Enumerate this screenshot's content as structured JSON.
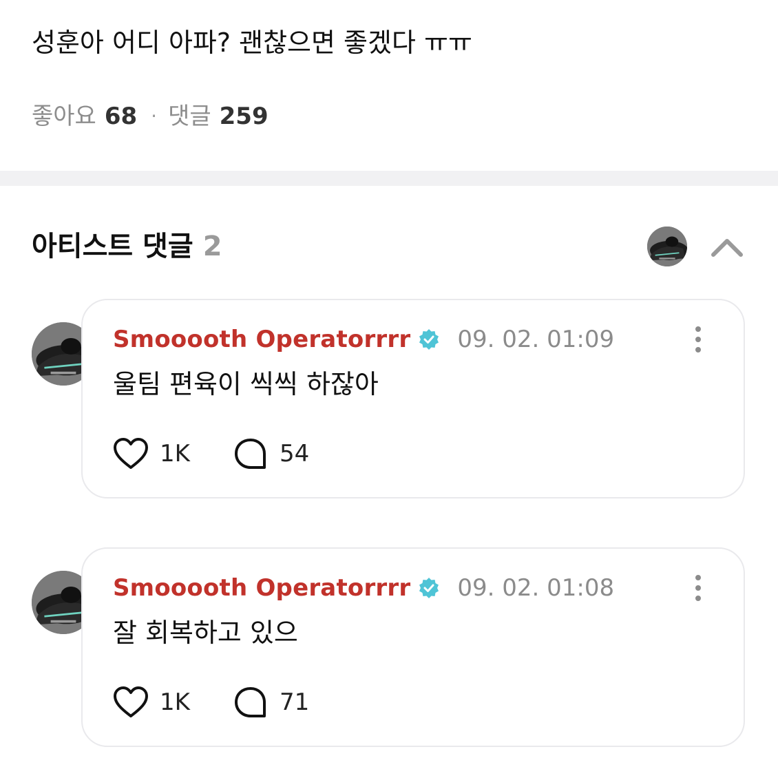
{
  "post": {
    "text": "성훈아 어디 아파? 괜찮으면 좋겠다 ㅠㅠ",
    "likes_label": "좋아요",
    "likes_count": "68",
    "separator": "·",
    "comments_label": "댓글",
    "comments_count": "259"
  },
  "artist_comments": {
    "title": "아티스트 댓글",
    "count": "2",
    "comments": [
      {
        "author": "Smooooth Operatorrrr",
        "timestamp": "09. 02. 01:09",
        "text": "울팀 편육이 씩씩 하잖아",
        "likes": "1K",
        "replies": "54"
      },
      {
        "author": "Smooooth Operatorrrr",
        "timestamp": "09. 02. 01:08",
        "text": "잘 회복하고 있으",
        "likes": "1K",
        "replies": "71"
      }
    ]
  },
  "icons": {
    "verified": "verified-badge-icon",
    "like": "heart-icon",
    "reply": "speech-bubble-icon",
    "more": "more-vertical-icon",
    "collapse": "chevron-up-icon"
  },
  "colors": {
    "author": "#c1322b",
    "verified": "#4fc4d6",
    "muted": "#8b8b8b",
    "divider": "#f1f1f3"
  }
}
